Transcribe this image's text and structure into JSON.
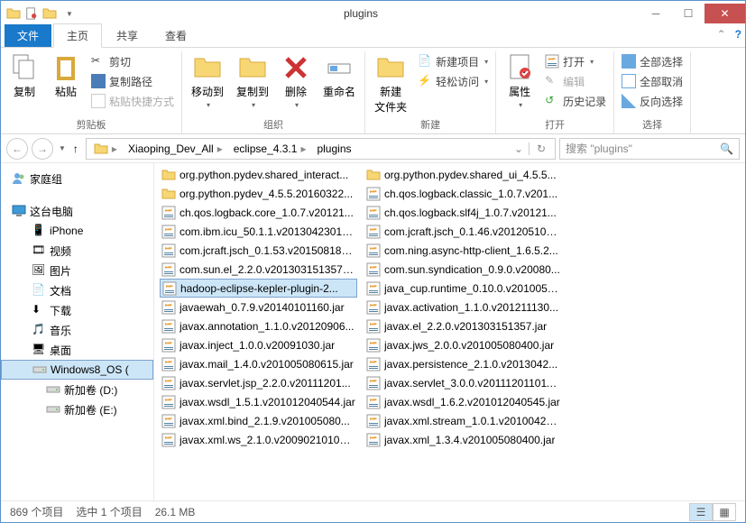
{
  "window": {
    "title": "plugins"
  },
  "tabs": {
    "file": "文件",
    "home": "主页",
    "share": "共享",
    "view": "查看"
  },
  "ribbon": {
    "clipboard": {
      "label": "剪贴板",
      "copy": "复制",
      "paste": "粘贴",
      "cut": "剪切",
      "copypath": "复制路径",
      "pasteShortcut": "粘贴快捷方式"
    },
    "organize": {
      "label": "组织",
      "moveTo": "移动到",
      "copyTo": "复制到",
      "delete": "删除",
      "rename": "重命名"
    },
    "new": {
      "label": "新建",
      "newFolder": "新建\n文件夹",
      "newItem": "新建项目",
      "easyAccess": "轻松访问"
    },
    "open": {
      "label": "打开",
      "properties": "属性",
      "open": "打开",
      "edit": "编辑",
      "history": "历史记录"
    },
    "select": {
      "label": "选择",
      "selectAll": "全部选择",
      "selectNone": "全部取消",
      "invert": "反向选择"
    }
  },
  "breadcrumb": {
    "items": [
      "Xiaoping_Dev_All",
      "eclipse_4.3.1",
      "plugins"
    ]
  },
  "search": {
    "placeholder": "搜索 \"plugins\""
  },
  "tree": {
    "homegroup": "家庭组",
    "thisPC": "这台电脑",
    "iphone": "iPhone",
    "videos": "视频",
    "pictures": "图片",
    "documents": "文档",
    "downloads": "下载",
    "music": "音乐",
    "desktop": "桌面",
    "win8": "Windows8_OS (",
    "driveD": "新加卷 (D:)",
    "driveE": "新加卷 (E:)"
  },
  "files_col1": [
    {
      "icon": "folder",
      "name": "org.python.pydev.shared_interact..."
    },
    {
      "icon": "folder",
      "name": "org.python.pydev_4.5.5.20160322..."
    },
    {
      "icon": "jar",
      "name": "ch.qos.logback.core_1.0.7.v20121..."
    },
    {
      "icon": "jar",
      "name": "com.ibm.icu_50.1.1.v201304230130..."
    },
    {
      "icon": "jar",
      "name": "com.jcraft.jsch_0.1.53.v201508180..."
    },
    {
      "icon": "jar",
      "name": "com.sun.el_2.2.0.v201303151357.j..."
    },
    {
      "icon": "jar",
      "name": "hadoop-eclipse-kepler-plugin-2...",
      "selected": true
    },
    {
      "icon": "jar",
      "name": "javaewah_0.7.9.v20140101160.jar"
    },
    {
      "icon": "jar",
      "name": "javax.annotation_1.1.0.v20120906..."
    },
    {
      "icon": "jar",
      "name": "javax.inject_1.0.0.v20091030.jar"
    },
    {
      "icon": "jar",
      "name": "javax.mail_1.4.0.v201005080615.jar"
    },
    {
      "icon": "jar",
      "name": "javax.servlet.jsp_2.2.0.v20111201..."
    },
    {
      "icon": "jar",
      "name": "javax.wsdl_1.5.1.v201012040544.jar"
    },
    {
      "icon": "jar",
      "name": "javax.xml.bind_2.1.9.v201005080..."
    },
    {
      "icon": "jar",
      "name": "javax.xml.ws_2.1.0.v200902101052..."
    }
  ],
  "files_col2": [
    {
      "icon": "folder",
      "name": "org.python.pydev.shared_ui_4.5.5..."
    },
    {
      "icon": "jar",
      "name": "ch.qos.logback.classic_1.0.7.v201..."
    },
    {
      "icon": "jar",
      "name": "ch.qos.logback.slf4j_1.0.7.v20121..."
    },
    {
      "icon": "jar",
      "name": "com.jcraft.jsch_0.1.46.v2012051020..."
    },
    {
      "icon": "jar",
      "name": "com.ning.async-http-client_1.6.5.2..."
    },
    {
      "icon": "jar",
      "name": "com.sun.syndication_0.9.0.v20080..."
    },
    {
      "icon": "jar",
      "name": "java_cup.runtime_0.10.0.v2010050..."
    },
    {
      "icon": "jar",
      "name": "javax.activation_1.1.0.v201211130..."
    },
    {
      "icon": "jar",
      "name": "javax.el_2.2.0.v201303151357.jar"
    },
    {
      "icon": "jar",
      "name": "javax.jws_2.0.0.v201005080400.jar"
    },
    {
      "icon": "jar",
      "name": "javax.persistence_2.1.0.v2013042..."
    },
    {
      "icon": "jar",
      "name": "javax.servlet_3.0.0.v201112011011..."
    },
    {
      "icon": "jar",
      "name": "javax.wsdl_1.6.2.v201012040545.jar"
    },
    {
      "icon": "jar",
      "name": "javax.xml.stream_1.0.1.v20100427..."
    },
    {
      "icon": "jar",
      "name": "javax.xml_1.3.4.v201005080400.jar"
    }
  ],
  "status": {
    "count": "869 个项目",
    "sel": "选中 1 个项目",
    "size": "26.1 MB"
  }
}
